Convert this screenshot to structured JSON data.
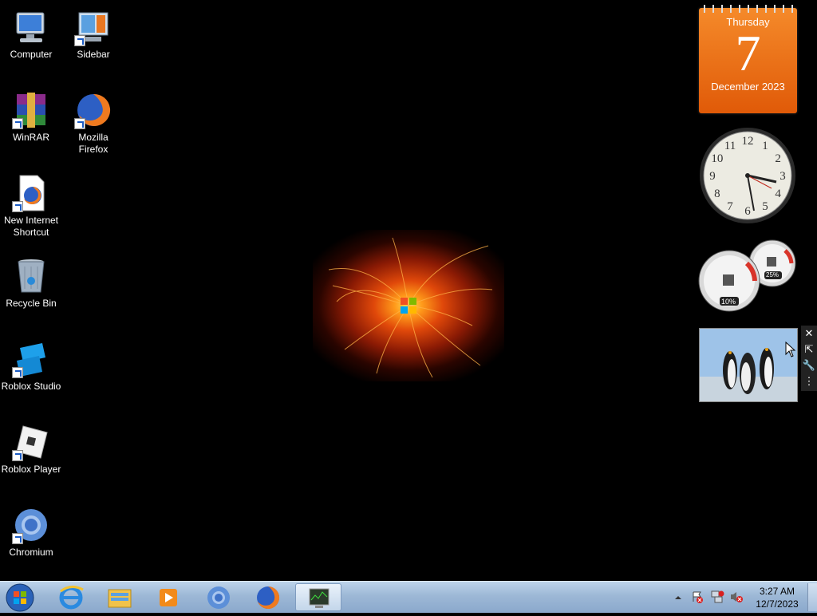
{
  "desktop_icons": [
    {
      "label_line1": "Computer",
      "label_line2": "",
      "icon": "computer-icon"
    },
    {
      "label_line1": "Sidebar",
      "label_line2": "",
      "icon": "sidebar-icon"
    },
    {
      "label_line1": "WinRAR",
      "label_line2": "",
      "icon": "winrar-icon"
    },
    {
      "label_line1": "Mozilla",
      "label_line2": "Firefox",
      "icon": "firefox-icon"
    },
    {
      "label_line1": "New Internet",
      "label_line2": "Shortcut",
      "icon": "internet-shortcut-icon"
    },
    {
      "label_line1": "Recycle Bin",
      "label_line2": "",
      "icon": "recycle-bin-icon"
    },
    {
      "label_line1": "Roblox Studio",
      "label_line2": "",
      "icon": "roblox-studio-icon"
    },
    {
      "label_line1": "Roblox Player",
      "label_line2": "",
      "icon": "roblox-player-icon"
    },
    {
      "label_line1": "Chromium",
      "label_line2": "",
      "icon": "chromium-icon"
    }
  ],
  "gadgets": {
    "calendar": {
      "weekday": "Thursday",
      "day": "7",
      "month_year": "December 2023"
    },
    "clock": {
      "numerals": [
        "12",
        "1",
        "2",
        "3",
        "4",
        "5",
        "6",
        "7",
        "8",
        "9",
        "10",
        "11"
      ]
    },
    "cpu_meter": {
      "cpu_percent": "10%",
      "memory_percent": "25%"
    },
    "slideshow": {
      "image": "penguins"
    },
    "toolbar": {
      "close": "✕",
      "size": "⇱",
      "options": "🔧",
      "drag": "⋮"
    }
  },
  "taskbar": {
    "pinned": [
      "internet-explorer-icon",
      "windows-explorer-icon",
      "media-player-icon",
      "chromium-icon",
      "firefox-icon",
      "task-manager-icon"
    ],
    "time": "3:27 AM",
    "date": "12/7/2023",
    "tray": [
      "show-hidden-icons",
      "action-center-icon",
      "network-icon",
      "volume-muted-icon"
    ]
  },
  "colors": {
    "taskbar": "#9db8d6",
    "calendar": "#e8650f"
  }
}
